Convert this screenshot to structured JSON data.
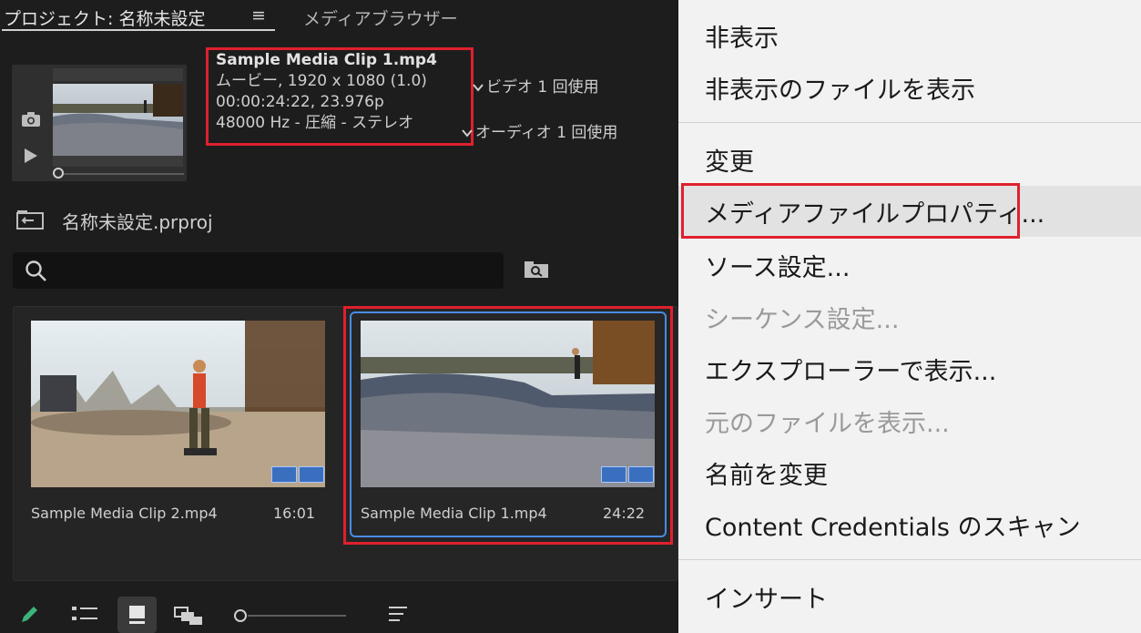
{
  "project_panel": {
    "tab_project": "プロジェクト: 名称未設定",
    "tab_menu_glyph": "≡",
    "tab_media_browser": "メディアブラウザー",
    "preview": {
      "title": "Sample Media Clip 1.mp4",
      "line1": "ムービー, 1920 x 1080 (1.0)",
      "line2": "00:00:24:22, 23.976p",
      "line3": "48000 Hz - 圧縮 - ステレオ",
      "video_usage": "ビデオ 1 回使用",
      "audio_usage": "オーディオ 1 回使用"
    },
    "project_file": "名称未設定.prproj",
    "search": {
      "placeholder": ""
    },
    "items": [
      {
        "name": "Sample Media Clip 2.mp4",
        "duration": "16:01",
        "selected": false
      },
      {
        "name": "Sample Media Clip 1.mp4",
        "duration": "24:22",
        "selected": true
      }
    ],
    "icons": [
      "camera-icon",
      "play-icon",
      "project-folder-icon",
      "search-icon",
      "find-icon",
      "video-badge-icon",
      "audio-badge-icon",
      "pencil-icon",
      "list-view-icon",
      "icon-view-icon",
      "freeform-view-icon",
      "sort-icon"
    ]
  },
  "context_menu": {
    "items": [
      {
        "label": "非表示",
        "enabled": true
      },
      {
        "label": "非表示のファイルを表示",
        "enabled": true
      },
      {
        "label": "変更",
        "enabled": true
      },
      {
        "label": "メディアファイルプロパティ...",
        "enabled": true,
        "hovered": true
      },
      {
        "label": "ソース設定...",
        "enabled": true
      },
      {
        "label": "シーケンス設定...",
        "enabled": false
      },
      {
        "label": "エクスプローラーで表示...",
        "enabled": true
      },
      {
        "label": "元のファイルを表示...",
        "enabled": false
      },
      {
        "label": "名前を変更",
        "enabled": true
      },
      {
        "label": "Content Credentials のスキャン",
        "enabled": true
      },
      {
        "label": "インサート",
        "enabled": true
      }
    ]
  },
  "colors": {
    "panel_bg": "#1d1d1d",
    "menu_bg": "#f2f2f2",
    "annotation_red": "#e0202e",
    "selection_blue": "#4a8be5",
    "badge_blue": "#3a6fbf"
  }
}
